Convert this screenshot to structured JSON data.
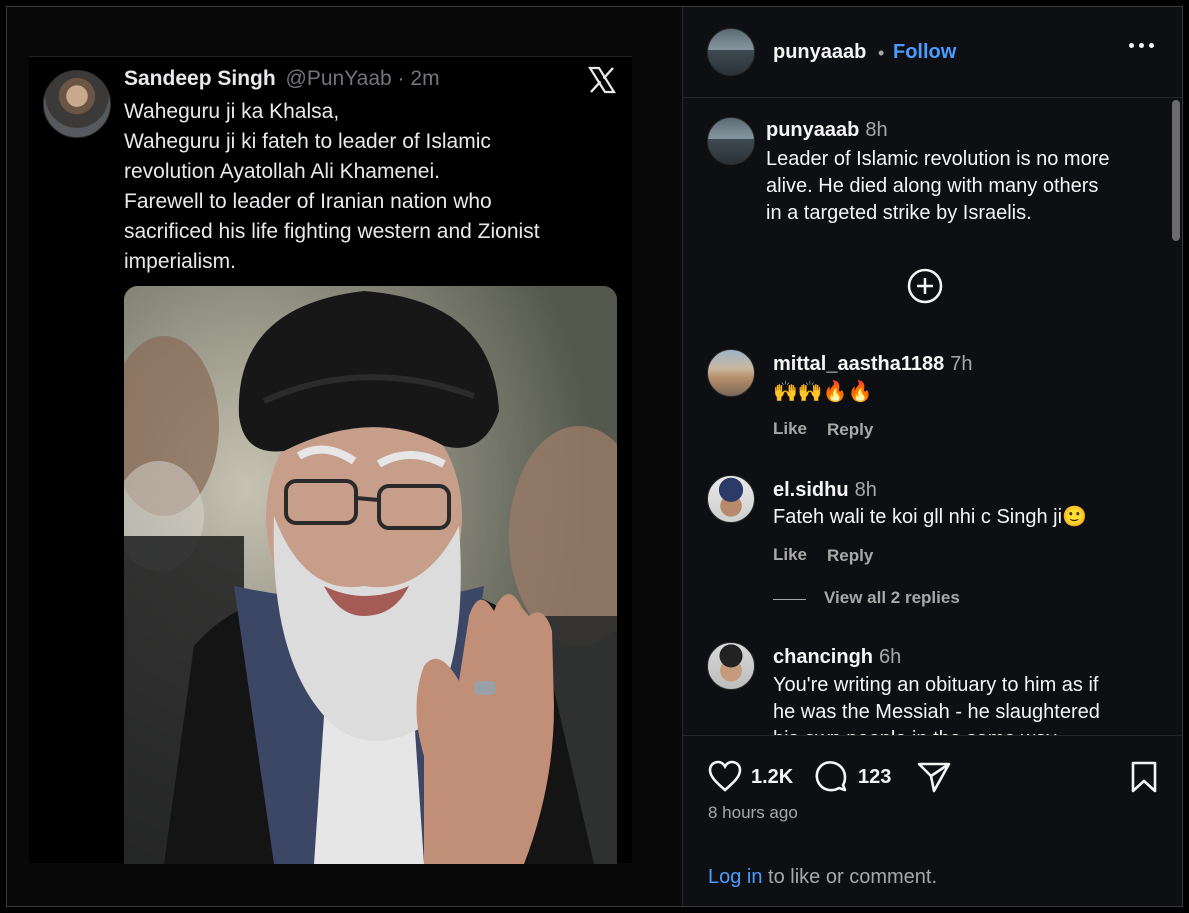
{
  "tweet": {
    "name": "Sandeep Singh",
    "handle": "@PunYaab",
    "dot": "·",
    "time": "2m",
    "lines": [
      "Waheguru ji ka Khalsa,",
      "Waheguru ji ki fateh to leader of Islamic",
      "revolution Ayatollah Ali Khamenei.",
      "Farewell to leader of Iranian nation who",
      "sacrificed his life fighting western and Zionist",
      "imperialism."
    ]
  },
  "post": {
    "username": "punyaaab",
    "separator": "•",
    "follow_label": "Follow",
    "caption_time": "8h",
    "caption_lines": [
      "Leader of Islamic revolution is no more",
      "alive. He died along with many others",
      "in a targeted  strike by Israelis."
    ]
  },
  "comments": [
    {
      "user": "mittal_aastha1188",
      "time": "7h",
      "text": "🙌🙌🔥🔥",
      "like": "Like",
      "reply": "Reply"
    },
    {
      "user": "el.sidhu",
      "time": "8h",
      "text": "Fateh wali te koi gll nhi c Singh ji🙂",
      "like": "Like",
      "reply": "Reply"
    },
    {
      "user": "chancingh",
      "time": "6h",
      "lines": [
        "You're writing an obituary to him as if",
        "he was the Messiah - he slaughtered",
        "his own people in the same way"
      ]
    }
  ],
  "view_replies": "View all 2 replies",
  "actions": {
    "likes": "1.2K",
    "comments": "123",
    "posted": "8 hours ago",
    "login_link": "Log in",
    "login_rest": " to like or comment."
  },
  "colors": {
    "link": "#4c9bff",
    "background": "#0e0f12",
    "muted": "#a8a8a8"
  }
}
